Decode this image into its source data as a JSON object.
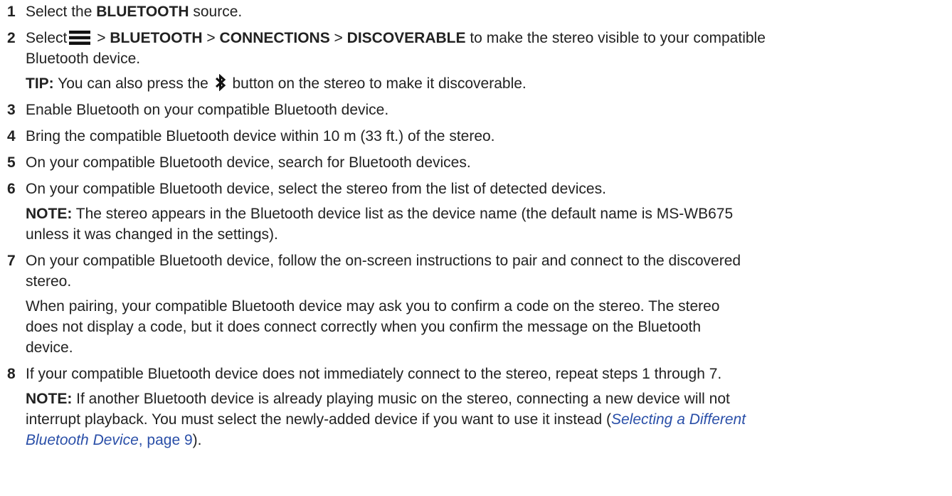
{
  "steps": [
    {
      "num": "1",
      "text_before": "Select the ",
      "bold": "BLUETOOTH",
      "text_after": " source."
    },
    {
      "num": "2",
      "select": "Select",
      "sep1": " > ",
      "bold1": "BLUETOOTH",
      "sep2": " > ",
      "bold2": "CONNECTIONS",
      "sep3": " > ",
      "bold3": "DISCOVERABLE",
      "text_after": " to make the stereo visible to your compatible",
      "line2": "Bluetooth device.",
      "tip_label": "TIP:",
      "tip_before": " You can also press the ",
      "tip_after": " button on the stereo to make it discoverable."
    },
    {
      "num": "3",
      "text": "Enable Bluetooth on your compatible Bluetooth device."
    },
    {
      "num": "4",
      "text": "Bring the compatible Bluetooth device within 10 m (33 ft.) of the stereo."
    },
    {
      "num": "5",
      "text": "On your compatible Bluetooth device, search for Bluetooth devices."
    },
    {
      "num": "6",
      "text": "On your compatible Bluetooth device, select the stereo from the list of detected devices.",
      "note_label": "NOTE:",
      "note_line1": " The stereo appears in the Bluetooth device list as the device name (the default name is MS-WB675",
      "note_line2": "unless it was changed in the settings)."
    },
    {
      "num": "7",
      "line1": "On your compatible Bluetooth device, follow the on-screen instructions to pair and connect to the discovered",
      "line2": "stereo.",
      "para_line1": "When pairing, your compatible Bluetooth device may ask you to confirm a code on the stereo. The stereo",
      "para_line2": "does not display a code, but it does connect correctly when you confirm the message on the Bluetooth",
      "para_line3": "device."
    },
    {
      "num": "8",
      "text": "If your compatible Bluetooth device does not immediately connect to the stereo, repeat steps 1 through 7.",
      "note_label": "NOTE:",
      "note_line1": " If another Bluetooth device is already playing music on the stereo, connecting a new device will not",
      "note_line2": "interrupt playback. You must select the newly-added device if you want to use it instead (",
      "link_line1": "Selecting a Different",
      "link_line2": "Bluetooth Device",
      "link_page": ", page 9",
      "note_end": ")."
    }
  ],
  "icons": {
    "menu": "hamburger-menu-icon",
    "bluetooth": "bluetooth-icon"
  },
  "colors": {
    "text": "#222222",
    "link": "#2a4fa8"
  }
}
